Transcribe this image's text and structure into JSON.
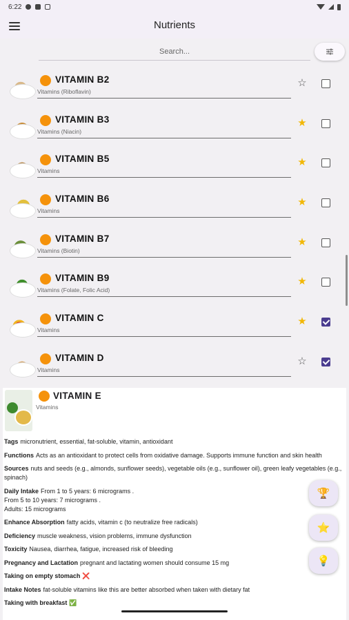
{
  "status_bar": {
    "time": "6:22"
  },
  "app": {
    "title": "Nutrients"
  },
  "search": {
    "placeholder": "Search..."
  },
  "items": [
    {
      "name": "VITAMIN B2",
      "category": "Vitamins (Riboflavin)",
      "favorite": false,
      "selected": false
    },
    {
      "name": "VITAMIN B3",
      "category": "Vitamins (Niacin)",
      "favorite": true,
      "selected": false
    },
    {
      "name": "VITAMIN B5",
      "category": "Vitamins",
      "favorite": true,
      "selected": false
    },
    {
      "name": "VITAMIN B6",
      "category": "Vitamins",
      "favorite": true,
      "selected": false
    },
    {
      "name": "VITAMIN B7",
      "category": "Vitamins (Biotin)",
      "favorite": true,
      "selected": false
    },
    {
      "name": "VITAMIN B9",
      "category": "Vitamins (Folate, Folic Acid)",
      "favorite": true,
      "selected": false
    },
    {
      "name": "VITAMIN C",
      "category": "Vitamins",
      "favorite": true,
      "selected": true
    },
    {
      "name": "VITAMIN D",
      "category": "Vitamins",
      "favorite": false,
      "selected": true
    }
  ],
  "detail": {
    "name": "VITAMIN E",
    "category": "Vitamins",
    "facts": [
      {
        "label": "Tags",
        "value": "micronutrient, essential, fat-soluble, vitamin, antioxidant"
      },
      {
        "label": "Functions",
        "value": "Acts as an antioxidant to protect cells from oxidative damage. Supports immune function and skin health"
      },
      {
        "label": "Sources",
        "value": "nuts and seeds (e.g., almonds, sunflower seeds), vegetable oils (e.g., sunflower oil), green leafy vegetables (e.g., spinach)"
      },
      {
        "label": "Daily Intake",
        "value": "From 1 to 5 years: 6 micrograms .\nFrom 5 to 10 years: 7 micrograms .\nAdults: 15 micrograms"
      },
      {
        "label": "Enhance Absorption",
        "value": "fatty acids, vitamin c (to neutralize free radicals)"
      },
      {
        "label": "Deficiency",
        "value": "muscle weakness, vision problems, immune dysfunction"
      },
      {
        "label": "Toxicity",
        "value": "Nausea, diarrhea, fatigue, increased risk of bleeding"
      },
      {
        "label": "Pregnancy and Lactation",
        "value": "pregnant and lactating women should consume 15 mg"
      },
      {
        "label": "Taking on empty stomach",
        "value": "❌"
      },
      {
        "label": "Intake Notes",
        "value": "fat-soluble vitamins like this are better absorbed when taken with dietary fat"
      },
      {
        "label": "Taking with breakfast",
        "value": "✅"
      }
    ]
  },
  "fabs": [
    {
      "icon": "trophy-icon",
      "glyph": "🏆"
    },
    {
      "icon": "star-icon",
      "glyph": "⭐"
    },
    {
      "icon": "lightbulb-icon",
      "glyph": "💡"
    }
  ],
  "colors": {
    "accent": "#4a3c8f",
    "favorite": "#f2b705",
    "dot": "#f5920b"
  }
}
